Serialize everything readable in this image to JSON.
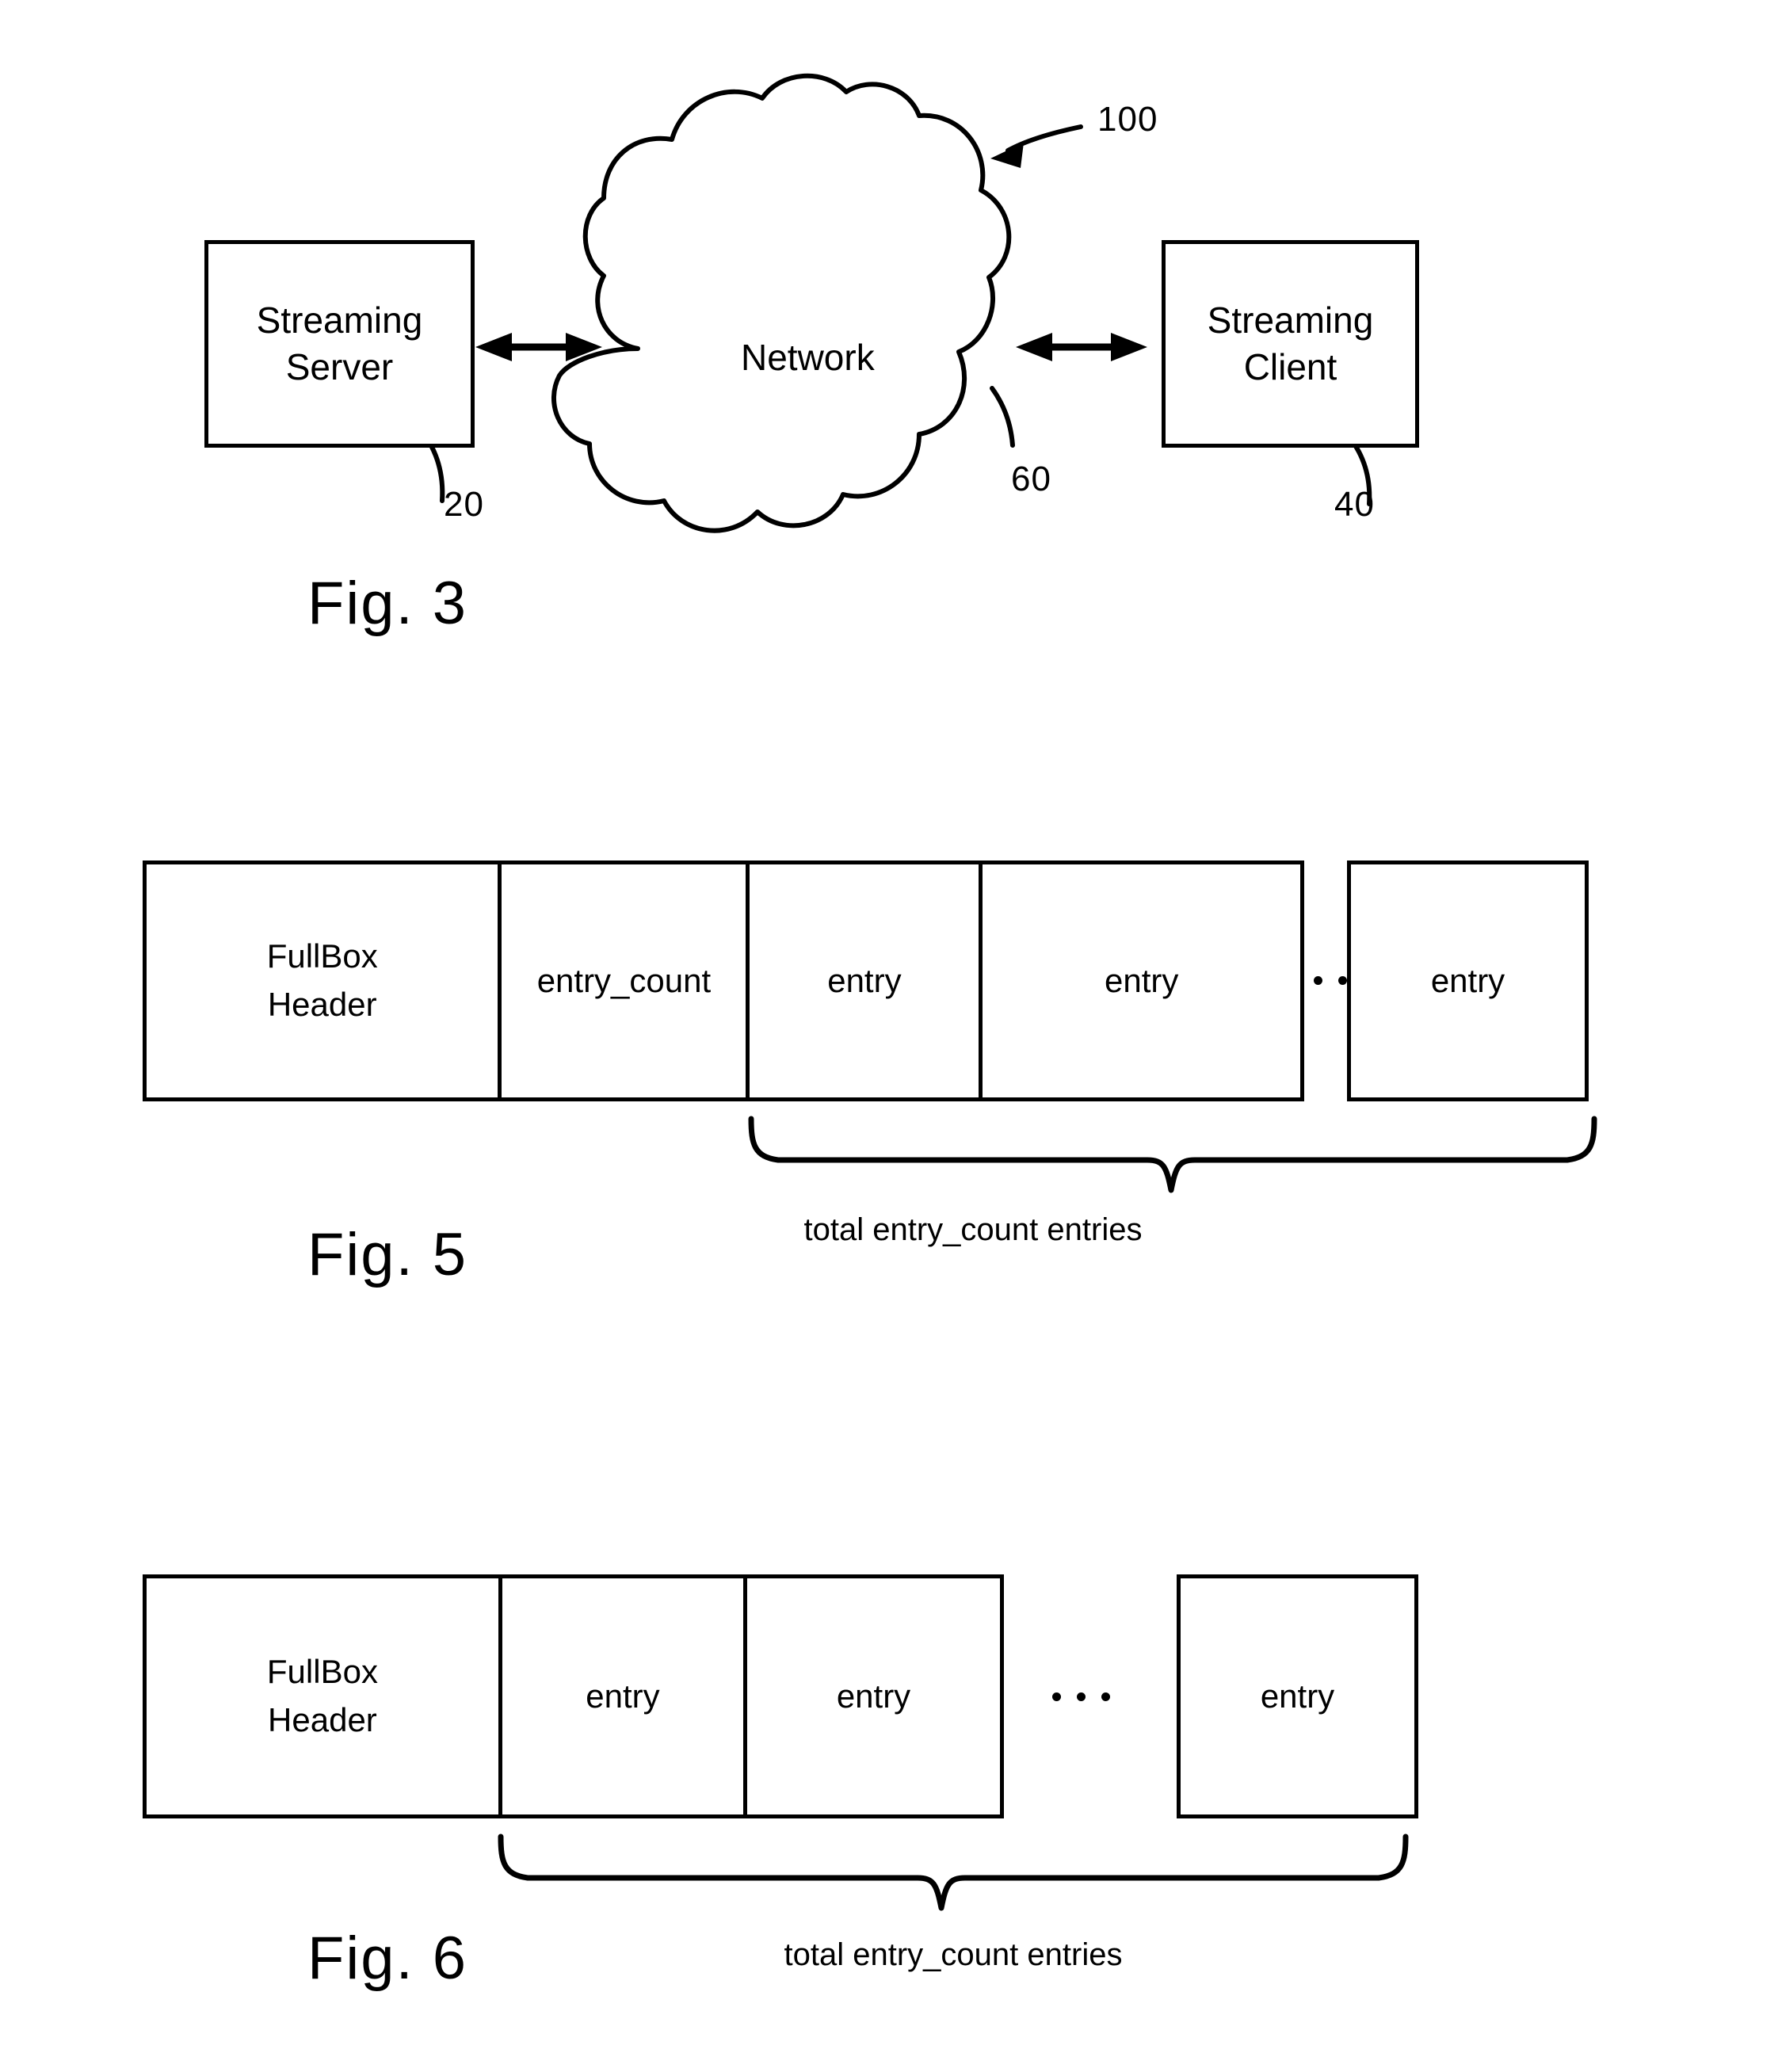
{
  "document": {
    "kind": "patent-drawing-sheet",
    "figures": [
      "Fig. 3",
      "Fig. 5",
      "Fig. 6"
    ]
  },
  "fig3": {
    "caption": "Fig. 3",
    "system_ref": "100",
    "server": {
      "label_line1": "Streaming",
      "label_line2": "Server",
      "ref": "20"
    },
    "network": {
      "label": "Network",
      "ref": "60"
    },
    "client": {
      "label_line1": "Streaming",
      "label_line2": "Client",
      "ref": "40"
    }
  },
  "fig5": {
    "caption": "Fig. 5",
    "cells": [
      {
        "line1": "FullBox",
        "line2": "Header"
      },
      {
        "line1": "entry_count",
        "line2": ""
      },
      {
        "line1": "entry",
        "line2": ""
      },
      {
        "line1": "entry",
        "line2": ""
      }
    ],
    "ellipsis": "· · ·",
    "last_cell": {
      "line1": "entry"
    },
    "brace_label": "total entry_count entries"
  },
  "fig6": {
    "caption": "Fig. 6",
    "cells": [
      {
        "line1": "FullBox",
        "line2": "Header"
      },
      {
        "line1": "entry",
        "line2": ""
      },
      {
        "line1": "entry",
        "line2": ""
      }
    ],
    "ellipsis": "· · ·",
    "last_cell": {
      "line1": "entry"
    },
    "brace_label": "total entry_count entries"
  },
  "colors": {
    "ink": "#000000",
    "paper": "#ffffff"
  }
}
